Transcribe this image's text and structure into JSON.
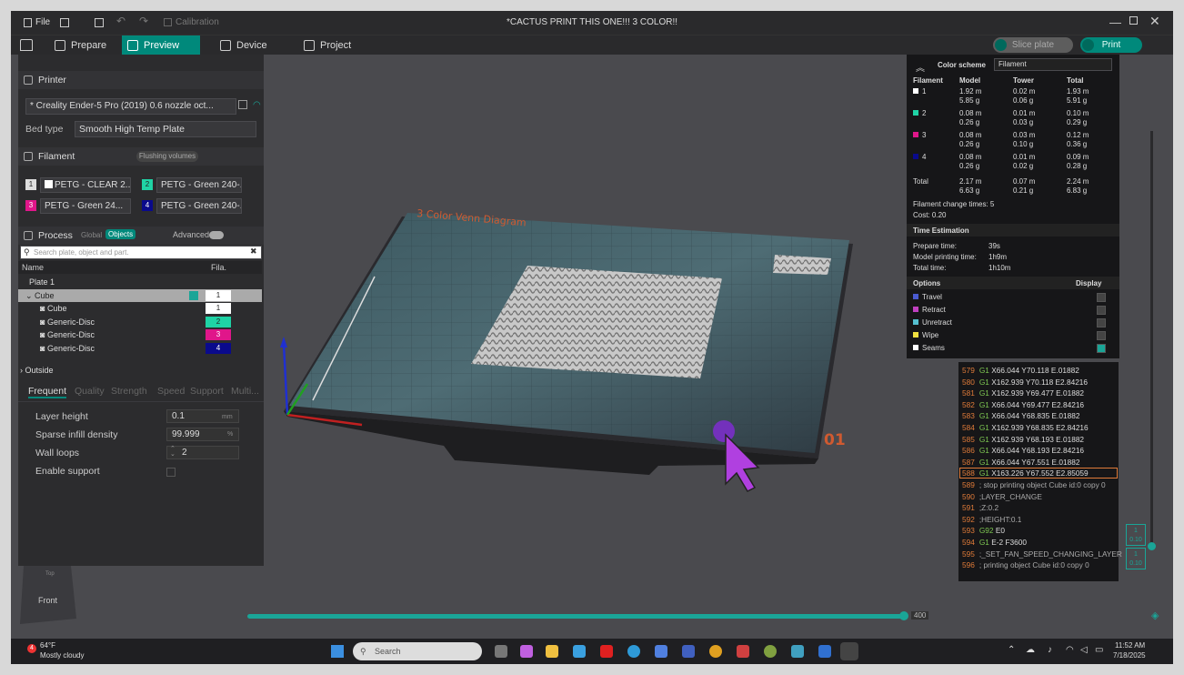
{
  "window": {
    "title": "*CACTUS PRINT THIS ONE!!! 3 COLOR!!",
    "file_label": "File",
    "calibration_label": "Calibration"
  },
  "tabs": [
    {
      "label": "Prepare"
    },
    {
      "label": "Preview"
    },
    {
      "label": "Device"
    },
    {
      "label": "Project"
    }
  ],
  "actions": {
    "slice_label": "Slice plate",
    "print_label": "Print"
  },
  "printer": {
    "section_label": "Printer",
    "name": "* Creality Ender-5 Pro (2019) 0.6 nozzle oct...",
    "bed_type_label": "Bed type",
    "bed_type_value": "Smooth High Temp Plate"
  },
  "filament": {
    "section_label": "Filament",
    "flushing_label": "Flushing volumes",
    "slots": [
      {
        "num": "1",
        "name": "PETG - CLEAR 2...",
        "color": "#ffffff"
      },
      {
        "num": "2",
        "name": "PETG - Green 240-...",
        "color": "#1fd3a5"
      },
      {
        "num": "3",
        "name": "PETG - Green 24...",
        "color": "#e0168a"
      },
      {
        "num": "4",
        "name": "PETG - Green 240-...",
        "color": "#0a0a8c"
      }
    ]
  },
  "process": {
    "section_label": "Process",
    "global_label": "Global",
    "objects_label": "Objects",
    "advanced_label": "Advanced",
    "search_placeholder": "Search plate, object and part.",
    "col_name": "Name",
    "col_fila": "Fila.",
    "tree": [
      {
        "label": "Plate 1",
        "indent": 0,
        "fila": ""
      },
      {
        "label": "Cube",
        "indent": 1,
        "fila": "1",
        "selected": true
      },
      {
        "label": "Cube",
        "indent": 2,
        "fila": "1"
      },
      {
        "label": "Generic-Disc",
        "indent": 2,
        "fila": "2"
      },
      {
        "label": "Generic-Disc",
        "indent": 2,
        "fila": "3"
      },
      {
        "label": "Generic-Disc",
        "indent": 2,
        "fila": "4"
      },
      {
        "label": "Outside",
        "indent": 0,
        "fila": ""
      }
    ],
    "param_tabs": [
      "Frequent",
      "Quality",
      "Strength",
      "Speed",
      "Support",
      "Multi..."
    ],
    "params": [
      {
        "label": "Layer height",
        "value": "0.1",
        "unit": "mm"
      },
      {
        "label": "Sparse infill density",
        "value": "99.999",
        "unit": "%"
      },
      {
        "label": "Wall loops",
        "value": "2",
        "unit": ""
      },
      {
        "label": "Enable support",
        "value": "",
        "unit": ""
      }
    ]
  },
  "scene": {
    "plate_title": "3 Color Venn Diagram",
    "plate_number": "01",
    "view_label_top": "Top",
    "view_label_front": "Front"
  },
  "stats": {
    "color_scheme_label": "Color scheme",
    "color_scheme_value": "Filament",
    "headers": [
      "Filament",
      "Model",
      "Tower",
      "Total"
    ],
    "rows": [
      {
        "num": "1",
        "color": "#ffffff",
        "model": [
          "1.92 m",
          "5.85 g"
        ],
        "tower": [
          "0.02 m",
          "0.06 g"
        ],
        "total": [
          "1.93 m",
          "5.91 g"
        ]
      },
      {
        "num": "2",
        "color": "#1fd3a5",
        "model": [
          "0.08 m",
          "0.26 g"
        ],
        "tower": [
          "0.01 m",
          "0.03 g"
        ],
        "total": [
          "0.10 m",
          "0.29 g"
        ]
      },
      {
        "num": "3",
        "color": "#e0168a",
        "model": [
          "0.08 m",
          "0.26 g"
        ],
        "tower": [
          "0.03 m",
          "0.10 g"
        ],
        "total": [
          "0.12 m",
          "0.36 g"
        ]
      },
      {
        "num": "4",
        "color": "#0a0a8c",
        "model": [
          "0.08 m",
          "0.26 g"
        ],
        "tower": [
          "0.01 m",
          "0.02 g"
        ],
        "total": [
          "0.09 m",
          "0.28 g"
        ]
      }
    ],
    "total": {
      "label": "Total",
      "model": [
        "2.17 m",
        "6.63 g"
      ],
      "tower": [
        "0.07 m",
        "0.21 g"
      ],
      "total": [
        "2.24 m",
        "6.83 g"
      ]
    },
    "filament_change": "Filament change times:  5",
    "cost": "Cost:  0.20",
    "time_heading": "Time Estimation",
    "prepare_label": "Prepare time:",
    "prepare_value": "39s",
    "model_time_label": "Model printing time:",
    "model_time_value": "1h9m",
    "total_time_label": "Total time:",
    "total_time_value": "1h10m",
    "options_label": "Options",
    "display_label": "Display",
    "options": [
      {
        "label": "Travel",
        "color": "#4a5ad0"
      },
      {
        "label": "Retract",
        "color": "#c040c0"
      },
      {
        "label": "Unretract",
        "color": "#55c0d0"
      },
      {
        "label": "Wipe",
        "color": "#f0e040"
      },
      {
        "label": "Seams",
        "color": "#ffffff"
      }
    ]
  },
  "gcode": [
    {
      "ln": "579",
      "cmd": "G1",
      "args": "X66.044 Y70.118 E.01882"
    },
    {
      "ln": "580",
      "cmd": "G1",
      "args": "X162.939 Y70.118 E2.84216"
    },
    {
      "ln": "581",
      "cmd": "G1",
      "args": "X162.939 Y69.477 E.01882"
    },
    {
      "ln": "582",
      "cmd": "G1",
      "args": "X66.044 Y69.477 E2.84216"
    },
    {
      "ln": "583",
      "cmd": "G1",
      "args": "X66.044 Y68.835 E.01882"
    },
    {
      "ln": "584",
      "cmd": "G1",
      "args": "X162.939 Y68.835 E2.84216"
    },
    {
      "ln": "585",
      "cmd": "G1",
      "args": "X162.939 Y68.193 E.01882"
    },
    {
      "ln": "586",
      "cmd": "G1",
      "args": "X66.044 Y68.193 E2.84216"
    },
    {
      "ln": "587",
      "cmd": "G1",
      "args": "X66.044 Y67.551 E.01882"
    },
    {
      "ln": "588",
      "cmd": "G1",
      "args": "X163.226 Y67.552 E2.85059",
      "hl": true
    },
    {
      "ln": "589",
      "cmd": "",
      "args": "; stop printing object Cube id:0 copy 0"
    },
    {
      "ln": "590",
      "cmd": "",
      "args": ";LAYER_CHANGE"
    },
    {
      "ln": "591",
      "cmd": "",
      "args": ";Z:0.2"
    },
    {
      "ln": "592",
      "cmd": "",
      "args": ";HEIGHT:0.1"
    },
    {
      "ln": "593",
      "cmd": "G92",
      "args": "E0"
    },
    {
      "ln": "594",
      "cmd": "G1",
      "args": "E-2 F3600"
    },
    {
      "ln": "595",
      "cmd": "",
      "args": ";_SET_FAN_SPEED_CHANGING_LAYER"
    },
    {
      "ln": "596",
      "cmd": "",
      "args": "; printing object Cube id:0 copy 0"
    }
  ],
  "layer_slider": {
    "top_layer": "400",
    "v_label_a": "1",
    "v_val_a": "0.10",
    "v_label_b": "1",
    "v_val_b": "0.10"
  },
  "taskbar": {
    "weather_temp": "64°F",
    "weather_desc": "Mostly cloudy",
    "search_placeholder": "Search",
    "time": "11:52 AM",
    "date": "7/18/2025",
    "badge": "4"
  }
}
